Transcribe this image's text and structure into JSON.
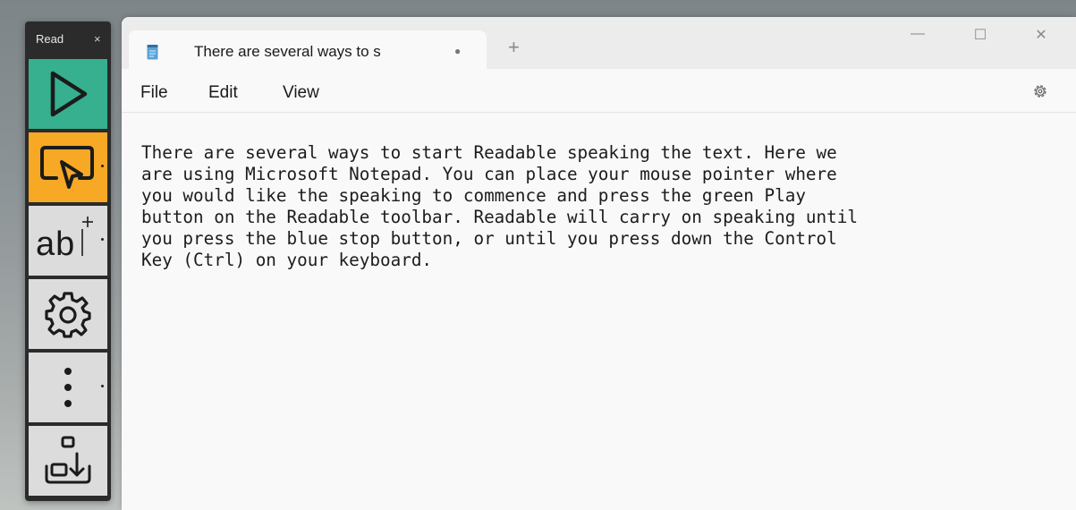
{
  "toolbar": {
    "title": "Read",
    "close_glyph": "×",
    "buttons": [
      {
        "name": "play",
        "icon": "play-icon",
        "color": "#36b08f"
      },
      {
        "name": "pointer",
        "icon": "screen-pointer-icon",
        "color": "#f7a825"
      },
      {
        "name": "ab",
        "icon": "ab-text-icon",
        "label": "ab",
        "color": "#dcdcdc"
      },
      {
        "name": "settings",
        "icon": "gear-icon",
        "color": "#dcdcdc"
      },
      {
        "name": "more",
        "icon": "more-vertical-icon",
        "color": "#dcdcdc"
      },
      {
        "name": "dock",
        "icon": "dock-download-icon",
        "color": "#dcdcdc"
      }
    ]
  },
  "notepad": {
    "tab_title": "There are several ways to s",
    "tab_modified_glyph": "●",
    "new_tab_glyph": "+",
    "window_controls": {
      "minimize": "—",
      "maximize": "☐",
      "close": "✕"
    },
    "menu": {
      "file": "File",
      "edit": "Edit",
      "view": "View"
    },
    "content": "There are several ways to start Readable speaking the text. Here we\nare using Microsoft Notepad. You can place your mouse pointer where\nyou would like the speaking to commence and press the green Play\nbutton on the Readable toolbar. Readable will carry on speaking until\nyou press the blue stop button, or until you press down the Control\nKey (Ctrl) on your keyboard."
  }
}
